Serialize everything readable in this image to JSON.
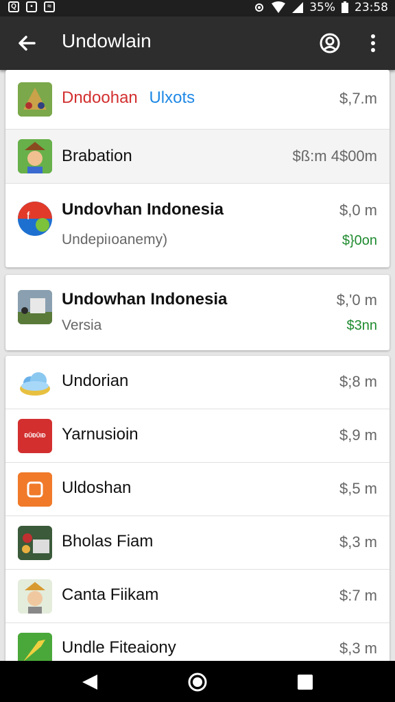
{
  "status_bar": {
    "left_icons": [
      "notification-icon",
      "image-icon",
      "photo-icon"
    ],
    "battery": "35%",
    "time": "23:58"
  },
  "app_bar": {
    "title": "Undowlain",
    "back_icon": "arrow-left-icon",
    "account_icon": "account-icon",
    "menu_icon": "more-vert-icon"
  },
  "cards": [
    {
      "rows": [
        {
          "name": "Dndoohan",
          "name_extra": "Ulxots",
          "price": "$,7.m"
        },
        {
          "name": "Brabation",
          "price": "$ß:m 4$00m"
        },
        {
          "name": "Undovhan Indonesia",
          "subtitle": "Undepiıoanemy)",
          "price": "$,0 m",
          "price2": "$}0on"
        }
      ]
    },
    {
      "rows": [
        {
          "name": "Undowhan Indonesia",
          "subtitle": "Versia",
          "price": "$,'0 m",
          "price2": "$3nn"
        }
      ]
    },
    {
      "rows": [
        {
          "name": "Undorian",
          "price": "$;8 m"
        },
        {
          "name": "Yarnusioin",
          "icon_text": "ÐŨĐŨIĐ",
          "price": "$,9 m"
        },
        {
          "name": "Uldoshan",
          "price": "$,5 m"
        },
        {
          "name": "Bholas Fiam",
          "price": "$,3 m"
        },
        {
          "name": "Canta Fiikam",
          "price": "$:7 m"
        },
        {
          "name": "Undle Fiteaiony",
          "price": "$,3 m"
        }
      ]
    }
  ],
  "colors": {
    "app_bar": "#2d2d2d",
    "red_label": "#d32f2f",
    "blue_label": "#1e88e5",
    "green_price": "#1e8a2e"
  },
  "nav_bar": {
    "back": "triangle-back-icon",
    "home": "circle-home-icon",
    "recents": "square-recents-icon"
  }
}
